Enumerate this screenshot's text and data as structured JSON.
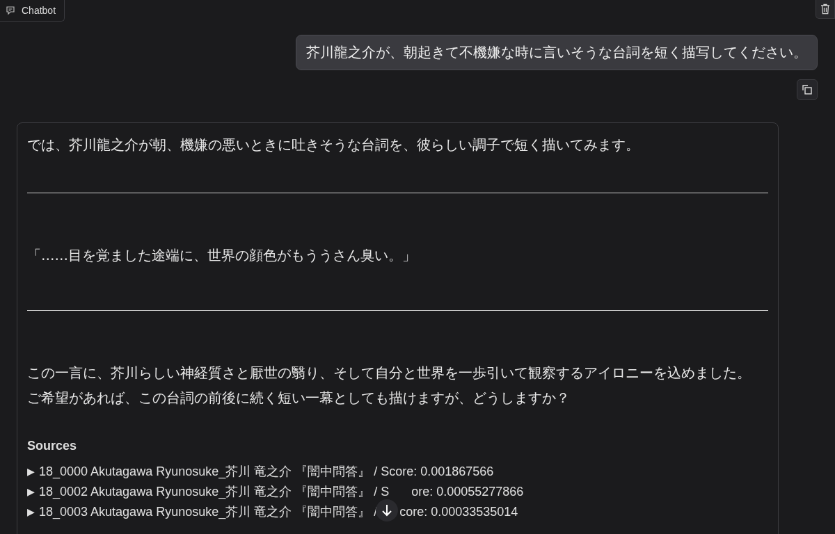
{
  "header": {
    "label": "Chatbot"
  },
  "messages": [
    {
      "kind": "user",
      "text": "芥川龍之介が、朝起きて不機嫌な時に言いそうな台詞を短く描写してください。"
    },
    {
      "kind": "bot",
      "blocks": [
        {
          "kind": "paragraph",
          "text": "では、芥川龍之介が朝、機嫌の悪いときに吐きそうな台詞を、彼らしい調子で短く描いてみます。"
        },
        {
          "kind": "rule"
        },
        {
          "kind": "paragraph",
          "text": "「……目を覚ました途端に、世界の顔色がもううさん臭い。」"
        },
        {
          "kind": "rule"
        },
        {
          "kind": "paragraph",
          "text": "この一言に、芥川らしい神経質さと厭世の翳り、そして自分と世界を一歩引いて観察するアイロニーを込めました。"
        },
        {
          "kind": "paragraph",
          "text": "ご希望があれば、この台詞の前後に続く短い一幕としても描けますが、どうしますか？"
        }
      ],
      "sources": {
        "title": "Sources",
        "items": [
          {
            "marker": "▶",
            "text": "18_0000 Akutagawa Ryunosuke_芥川 竜之介 『闇中問答』 / Score: 0.001867566"
          },
          {
            "marker": "▶",
            "text": "18_0002 Akutagawa Ryunosuke_芥川 竜之介 『闇中問答』 / S",
            "text_after": "ore: 0.00055277866"
          },
          {
            "marker": "▶",
            "text": "18_0003 Akutagawa Ryunosuke_芥川 竜之介 『闇中問答』 /",
            "text_after": "core: 0.00033535014"
          }
        ]
      }
    }
  ]
}
